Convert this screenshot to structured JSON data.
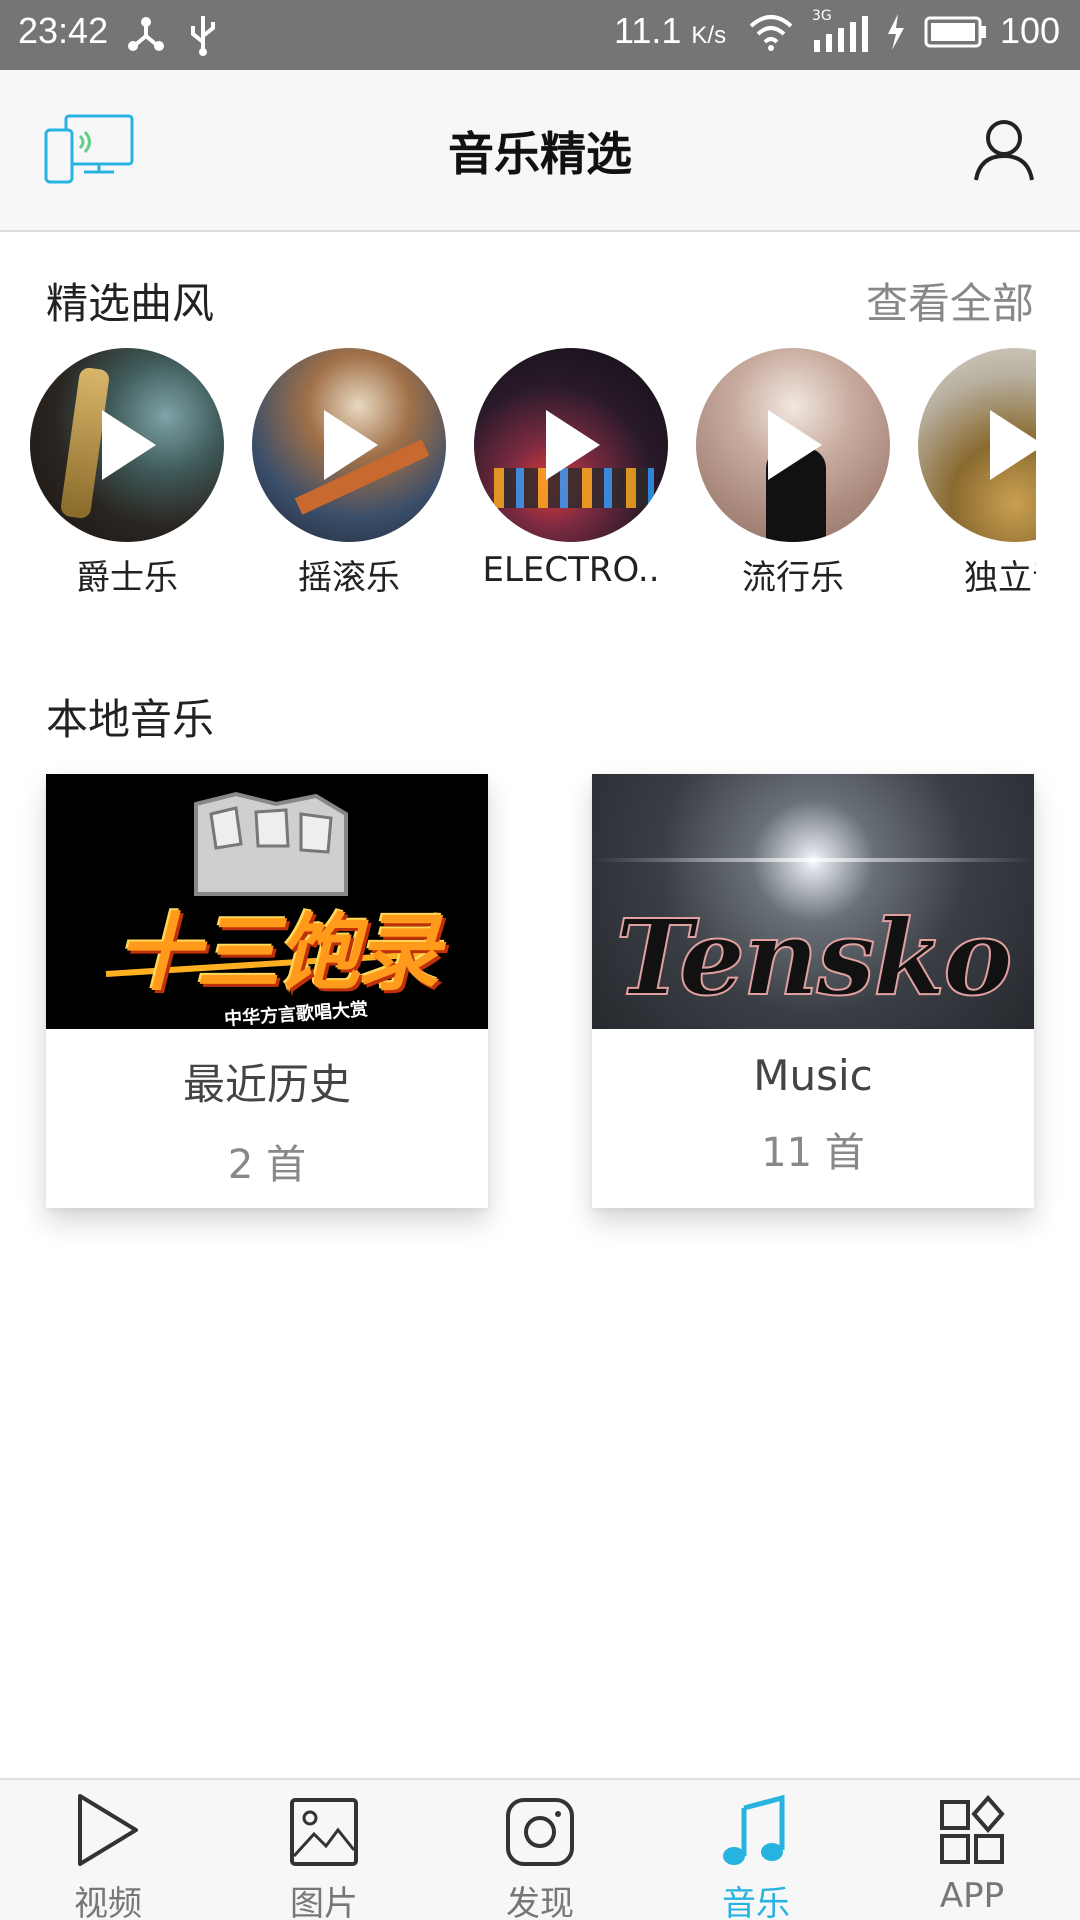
{
  "status_bar": {
    "time": "23:42",
    "speed": "11.1",
    "speed_unit": "K/s",
    "network": "3G",
    "battery": "100",
    "icons": [
      "share-icon",
      "usb-icon",
      "wifi-icon",
      "signal-icon",
      "charging-icon",
      "battery-icon"
    ]
  },
  "header": {
    "title": "音乐精选",
    "cast_icon": "screen-cast-icon",
    "user_icon": "user-icon",
    "accent_color": "#27b3e0"
  },
  "genres_section": {
    "title": "精选曲风",
    "see_all": "查看全部",
    "items": [
      {
        "label": "爵士乐",
        "icon": "play-icon"
      },
      {
        "label": "摇滚乐",
        "icon": "play-icon"
      },
      {
        "label": "ELECTRO..",
        "icon": "play-icon"
      },
      {
        "label": "流行乐",
        "icon": "play-icon"
      },
      {
        "label": "独立音",
        "icon": "play-icon"
      }
    ]
  },
  "local_section": {
    "title": "本地音乐",
    "cards": [
      {
        "name": "最近历史",
        "count": "2 首",
        "cover_text": "十三饱录",
        "cover_sub": "中华方言歌唱大赏"
      },
      {
        "name": "Music",
        "count": "11 首",
        "cover_text": "Tensko"
      }
    ]
  },
  "bottom_nav": {
    "items": [
      {
        "label": "视频",
        "icon": "video-play-icon",
        "active": false
      },
      {
        "label": "图片",
        "icon": "picture-icon",
        "active": false
      },
      {
        "label": "发现",
        "icon": "discover-icon",
        "active": false
      },
      {
        "label": "音乐",
        "icon": "music-note-icon",
        "active": true
      },
      {
        "label": "APP",
        "icon": "apps-icon",
        "active": false
      }
    ],
    "active_color": "#27b3e0",
    "inactive_color": "#777777"
  }
}
